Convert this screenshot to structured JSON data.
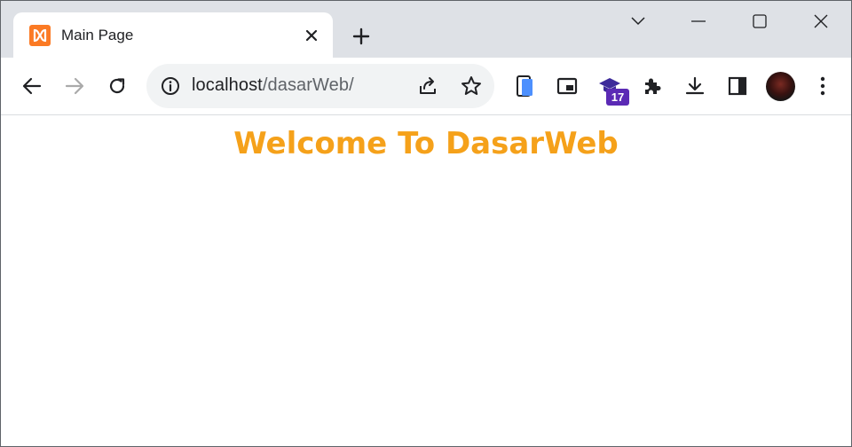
{
  "tab": {
    "title": "Main Page",
    "favicon": "xampp-icon"
  },
  "address_bar": {
    "host": "localhost",
    "path": "/dasarWeb/"
  },
  "extensions": {
    "badge_count": "17"
  },
  "page": {
    "heading": "Welcome To DasarWeb"
  },
  "colors": {
    "heading": "#f5a11a",
    "tabbar": "#dee1e6",
    "omnibox": "#f1f3f4",
    "favicon": "#fb7a24",
    "badge": "#5b2ab5"
  }
}
